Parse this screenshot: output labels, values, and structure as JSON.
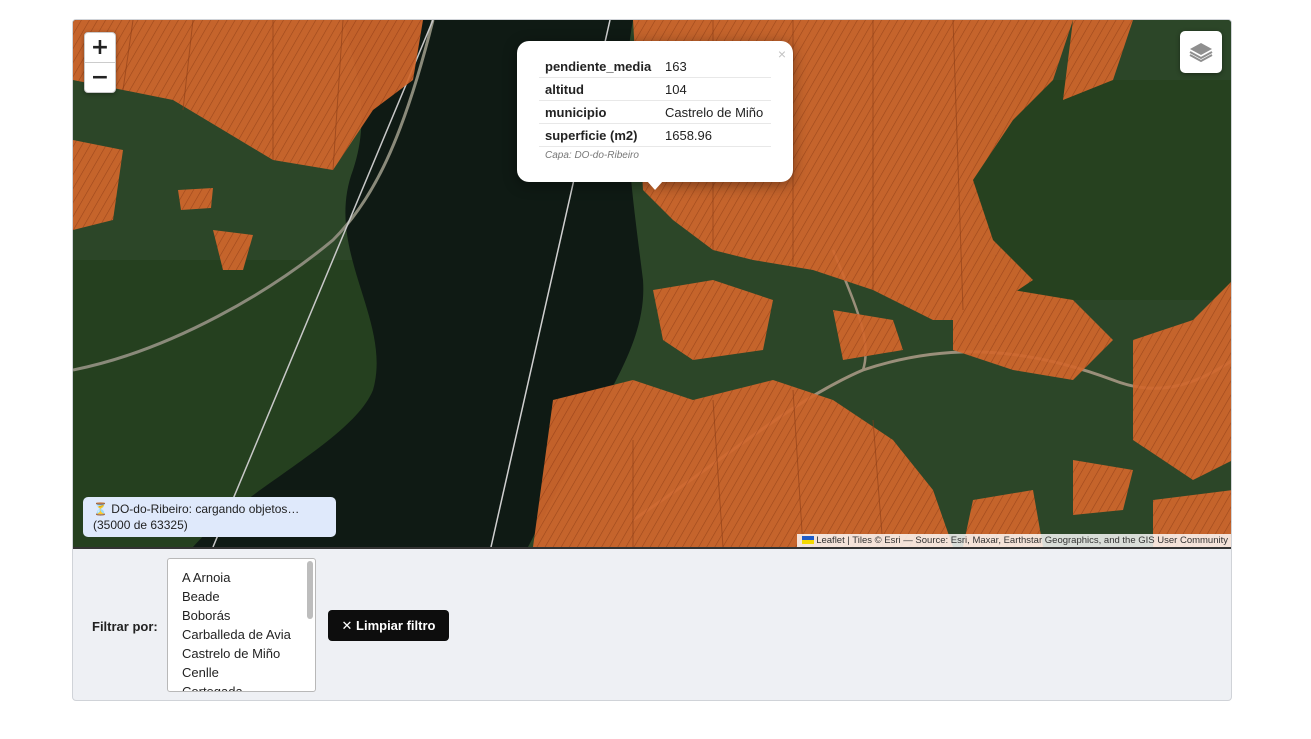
{
  "map": {
    "zoom_in": "+",
    "zoom_out": "−",
    "layers_icon": "layers-icon"
  },
  "popup": {
    "rows": [
      {
        "key": "pendiente_media",
        "value": "163"
      },
      {
        "key": "altitud",
        "value": "104"
      },
      {
        "key": "municipio",
        "value": "Castrelo de Miño"
      },
      {
        "key": "superficie (m2)",
        "value": "1658.96"
      }
    ],
    "source": "Capa: DO-do-Ribeiro",
    "close": "×"
  },
  "status": {
    "icon": "⏳",
    "line1": "DO-do-Ribeiro: cargando objetos…",
    "line2": "(35000 de 63325)"
  },
  "attribution": "Leaflet | Tiles © Esri — Source: Esri, Maxar, Earthstar Geographics, and the GIS User Community",
  "filter": {
    "label": "Filtrar por:",
    "options": [
      "A Arnoia",
      "Beade",
      "Boborás",
      "Carballeda de Avia",
      "Castrelo de Miño",
      "Cenlle",
      "Cortegada"
    ],
    "clear_button": "✕ Limpiar filtro"
  },
  "colors": {
    "parcel_fill": "#d0652a",
    "river": "#0f1a14",
    "forest": "#2c4628"
  }
}
